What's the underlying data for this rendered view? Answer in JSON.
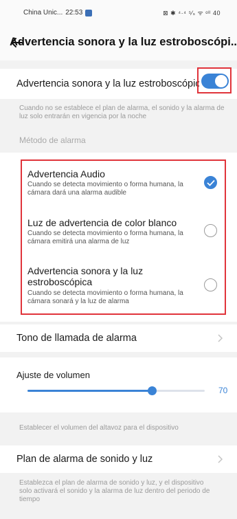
{
  "status_bar": {
    "carrier": "China Unic...",
    "time": "22:53",
    "indicators": "⊠ ✱ ⁴·⁴ ⁵⁄ₛ ᯤ ᵒˡˡ 40"
  },
  "header": {
    "title": "Advertencia sonora y la luz estroboscópi..."
  },
  "main_toggle": {
    "label": "Advertencia sonora y la luz estroboscópica",
    "enabled": true
  },
  "night_note": "Cuando no se establece el plan de alarma, el sonido y la alarma de luz solo entrarán en vigencia por la noche",
  "alarm_method": {
    "section_label": "Método de alarma",
    "options": [
      {
        "title": "Advertencia Audio",
        "desc": "Cuando se detecta movimiento o forma humana, la cámara dará una alarma audible",
        "selected": true
      },
      {
        "title": "Luz de advertencia de color blanco",
        "desc": "Cuando se detecta movimiento o forma humana, la cámara emitirá una alarma de luz",
        "selected": false
      },
      {
        "title": "Advertencia sonora y la luz estroboscópica",
        "desc": "Cuando se detecta movimiento o forma humana, la cámara sonará y la luz de alarma",
        "selected": false
      }
    ]
  },
  "ringtone": {
    "label": "Tono de llamada de alarma"
  },
  "volume": {
    "label": "Ajuste de volumen",
    "value": 70,
    "max": 100,
    "value_text": "70",
    "note": "Establecer el volumen del altavoz para el dispositivo"
  },
  "plan": {
    "label": "Plan de alarma de sonido y luz",
    "note": "Establezca el plan de alarma de sonido y luz, y el dispositivo solo activará el sonido y la alarma de luz dentro del periodo de tiempo"
  },
  "colors": {
    "accent": "#3a83d6",
    "highlight": "#e0333a"
  }
}
